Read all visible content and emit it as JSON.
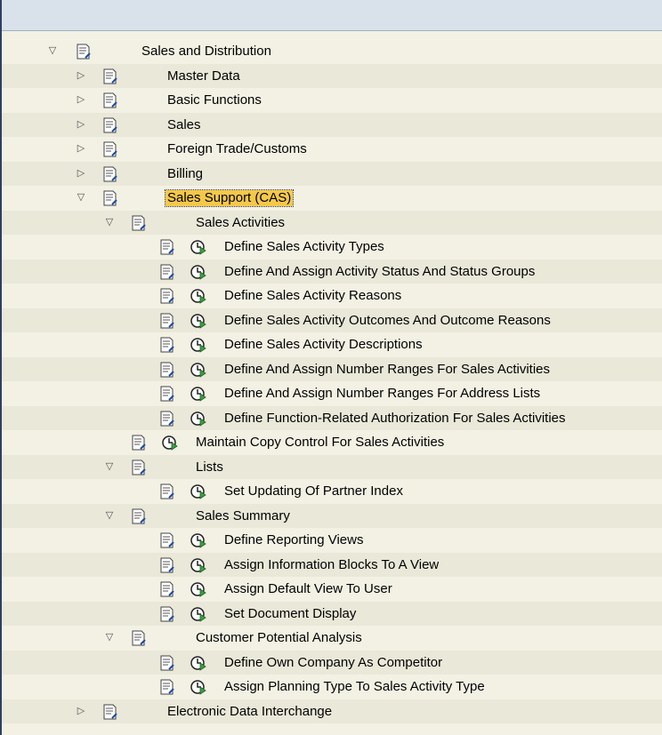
{
  "tree": {
    "rows": [
      {
        "label": "Sales and Distribution"
      },
      {
        "label": "Master Data"
      },
      {
        "label": "Basic Functions"
      },
      {
        "label": "Sales"
      },
      {
        "label": "Foreign Trade/Customs"
      },
      {
        "label": "Billing"
      },
      {
        "label": "Sales Support (CAS)"
      },
      {
        "label": "Sales Activities"
      },
      {
        "label": "Define Sales Activity Types"
      },
      {
        "label": "Define And Assign Activity Status And Status Groups"
      },
      {
        "label": "Define Sales Activity Reasons"
      },
      {
        "label": "Define Sales Activity Outcomes And Outcome Reasons"
      },
      {
        "label": "Define Sales Activity Descriptions"
      },
      {
        "label": "Define And Assign Number Ranges For Sales Activities"
      },
      {
        "label": "Define And Assign Number Ranges For Address Lists"
      },
      {
        "label": "Define Function-Related Authorization For Sales Activities"
      },
      {
        "label": "Maintain Copy Control For Sales Activities"
      },
      {
        "label": "Lists"
      },
      {
        "label": "Set Updating Of Partner Index"
      },
      {
        "label": "Sales Summary"
      },
      {
        "label": "Define Reporting Views"
      },
      {
        "label": "Assign Information Blocks To A View"
      },
      {
        "label": "Assign Default View To User"
      },
      {
        "label": "Set Document Display"
      },
      {
        "label": "Customer Potential Analysis"
      },
      {
        "label": "Define Own Company As Competitor"
      },
      {
        "label": "Assign Planning Type To Sales Activity Type"
      },
      {
        "label": "Electronic Data Interchange"
      }
    ],
    "icons": {
      "expanded": "triangle-down-icon",
      "collapsed": "triangle-right-icon",
      "document": "document-icon",
      "execute": "clock-execute-icon"
    },
    "colors": {
      "background": "#f2f1e4",
      "alt_row": "#e9e8d9",
      "header": "#d9e2ea",
      "selected": "#f5c84a",
      "frame_border": "#2f3f64"
    }
  }
}
